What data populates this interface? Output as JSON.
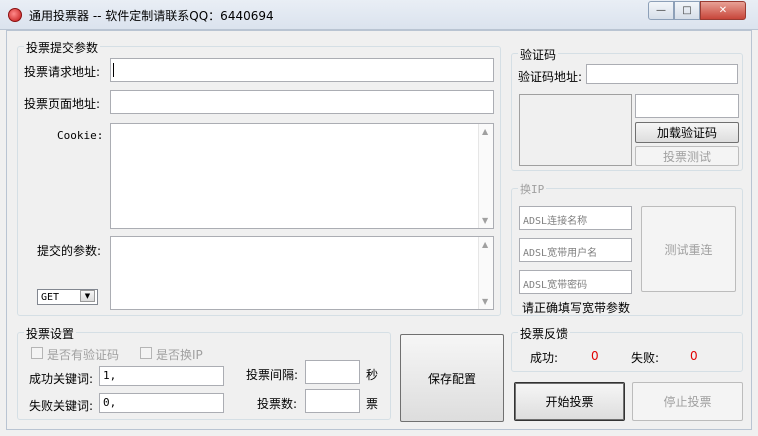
{
  "window": {
    "title": "通用投票器 -- 软件定制请联系QQ：6440694",
    "minimize_glyph": "—",
    "maximize_glyph": "□",
    "close_glyph": "✕"
  },
  "submit_params": {
    "group_label": "投票提交参数",
    "request_url_label": "投票请求地址:",
    "request_url_value": "",
    "page_url_label": "投票页面地址:",
    "page_url_value": "",
    "cookie_label": "Cookie:",
    "cookie_value": "",
    "params_label": "提交的参数:",
    "params_value": "",
    "method_selected": "GET"
  },
  "captcha": {
    "group_label": "验证码",
    "url_label": "验证码地址:",
    "url_value": "",
    "code_value": "",
    "load_button": "加载验证码",
    "test_button": "投票测试"
  },
  "change_ip": {
    "group_label": "换IP",
    "adsl_name_placeholder": "ADSL连接名称",
    "adsl_user_placeholder": "ADSL宽带用户名",
    "adsl_password_placeholder": "ADSL宽带密码",
    "hint": "请正确填写宽带参数",
    "redial_button": "测试重连"
  },
  "settings": {
    "group_label": "投票设置",
    "captcha_checkbox": "是否有验证码",
    "change_ip_checkbox": "是否换IP",
    "success_keyword_label": "成功关键词:",
    "success_keyword_value": "1,",
    "fail_keyword_label": "失败关键词:",
    "fail_keyword_value": "0,",
    "interval_label": "投票间隔:",
    "interval_value": "",
    "interval_unit": "秒",
    "count_label": "投票数:",
    "count_value": "",
    "count_unit": "票",
    "save_button": "保存配置"
  },
  "feedback": {
    "group_label": "投票反馈",
    "success_label": "成功:",
    "success_count": "0",
    "fail_label": "失败:",
    "fail_count": "0"
  },
  "actions": {
    "start_button": "开始投票",
    "stop_button": "停止投票"
  }
}
